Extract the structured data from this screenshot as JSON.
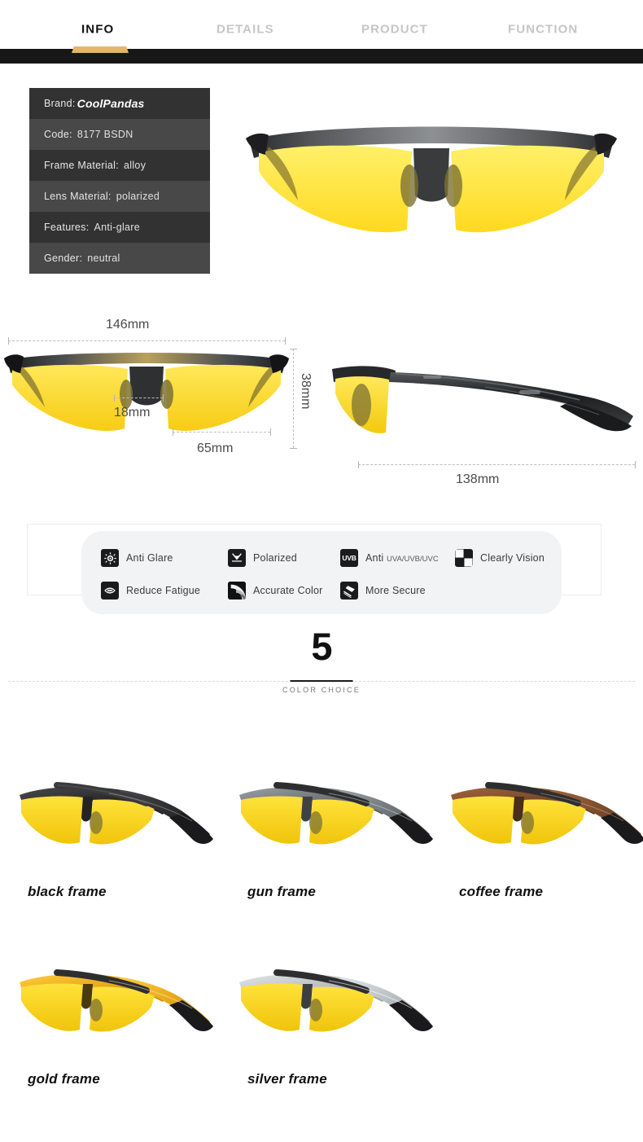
{
  "nav": {
    "tabs": [
      {
        "label": "INFO",
        "active": true
      },
      {
        "label": "DETAILS",
        "active": false
      },
      {
        "label": "PRODUCT",
        "active": false
      },
      {
        "label": "FUNCTION",
        "active": false
      }
    ],
    "accent_color": "#e3b669",
    "bar_color": "#171717"
  },
  "spec": {
    "rows": [
      {
        "key": "Brand:",
        "value": "CoolPandas",
        "brand": true
      },
      {
        "key": "Code:",
        "value": "8177 BSDN"
      },
      {
        "key": "Frame Material:",
        "value": "alloy"
      },
      {
        "key": "Lens Material:",
        "value": "polarized"
      },
      {
        "key": "Features:",
        "value": "Anti-glare"
      },
      {
        "key": "Gender:",
        "value": "neutral"
      }
    ]
  },
  "dimensions": {
    "width_total": "146mm",
    "bridge": "18mm",
    "lens_height": "38mm",
    "lens_width": "65mm",
    "temple_length": "138mm"
  },
  "features": {
    "items": [
      {
        "icon": "sun-anti-glare-icon",
        "label": "Anti Glare"
      },
      {
        "icon": "polarized-arrow-icon",
        "label": "Polarized"
      },
      {
        "icon": "uvb-badge-icon",
        "label": "Anti ",
        "label_small": "UVA/UVB/UVC"
      },
      {
        "icon": "checkerboard-icon",
        "label": "Clearly Vision"
      },
      {
        "icon": "eye-reduce-fatigue-icon",
        "label": "Reduce Fatigue"
      },
      {
        "icon": "color-swirl-icon",
        "label": "Accurate Color"
      },
      {
        "icon": "hammer-secure-icon",
        "label": "More Secure"
      }
    ]
  },
  "color_choice": {
    "count": "5",
    "subtitle": "COLOR CHOICE"
  },
  "variants": [
    {
      "label": "black frame",
      "frame_color": "#2c2c2e",
      "frame_color2": "#4a4a4d",
      "tip_color": "#1c1c1e",
      "lens": "#f5d21e"
    },
    {
      "label": "gun frame",
      "frame_color": "#6f7478",
      "frame_color2": "#9aa0a4",
      "tip_color": "#1c1c1e",
      "lens": "#f5d21e"
    },
    {
      "label": "coffee frame",
      "frame_color": "#7b4a2c",
      "frame_color2": "#a0653c",
      "tip_color": "#1c1c1e",
      "lens": "#f5d21e"
    },
    {
      "label": "gold frame",
      "frame_color": "#e8a81b",
      "frame_color2": "#ffce3d",
      "tip_color": "#1c1c1e",
      "lens": "#f5d21e"
    },
    {
      "label": "silver frame",
      "frame_color": "#b9bec2",
      "frame_color2": "#e3e7ea",
      "tip_color": "#1c1c1e",
      "lens": "#f5d21e"
    }
  ]
}
